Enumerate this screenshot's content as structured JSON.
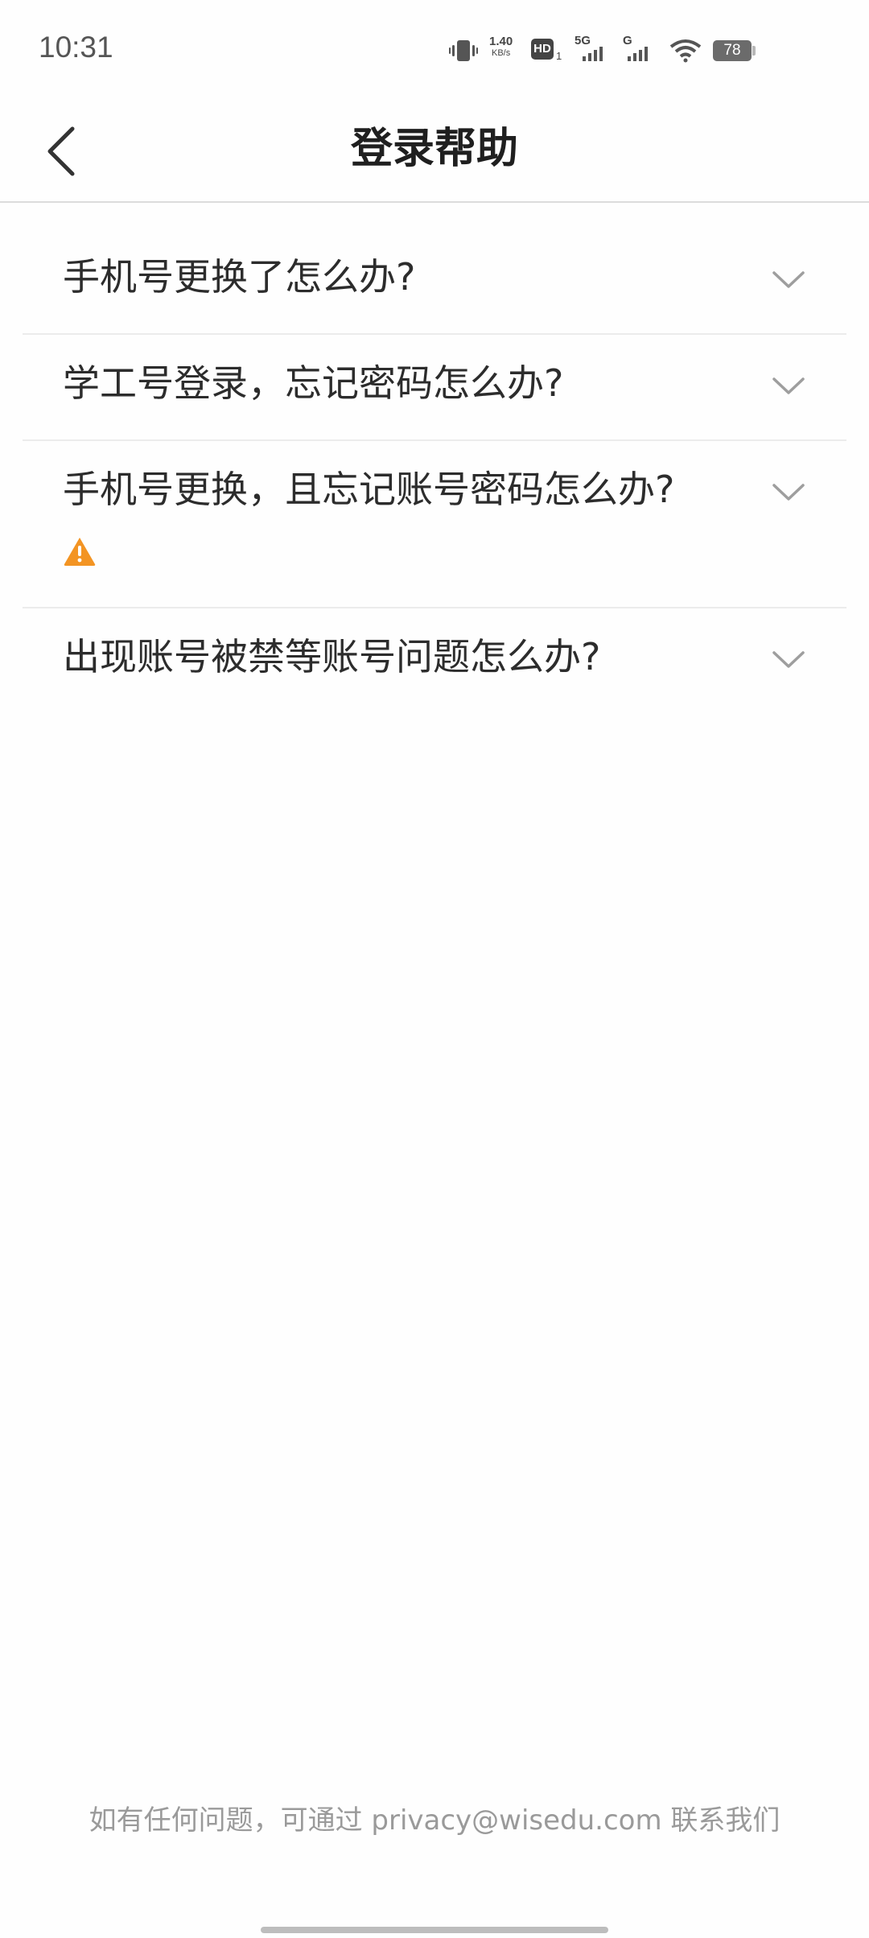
{
  "status_bar": {
    "time": "10:31",
    "net_speed_value": "1.40",
    "net_speed_unit": "KB/s",
    "hd_label": "HD",
    "hd_sub": "1",
    "signal1_label": "5G",
    "signal2_label": "G",
    "battery_level": "78"
  },
  "nav": {
    "title": "登录帮助",
    "back_icon": "chevron-left-icon"
  },
  "faq": {
    "items": [
      {
        "question": "手机号更换了怎么办?"
      },
      {
        "question": "学工号登录，忘记密码怎么办?"
      },
      {
        "question": "手机号更换，且忘记账号密码怎么办?",
        "badge_icon": "warning-icon"
      },
      {
        "question": "出现账号被禁等账号问题怎么办?"
      }
    ]
  },
  "footer": {
    "note": "如有任何问题，可通过 privacy@wisedu.com 联系我们"
  },
  "colors": {
    "warning": "#F39423",
    "chevron": "#9e9e9e",
    "divider": "#ececec"
  }
}
